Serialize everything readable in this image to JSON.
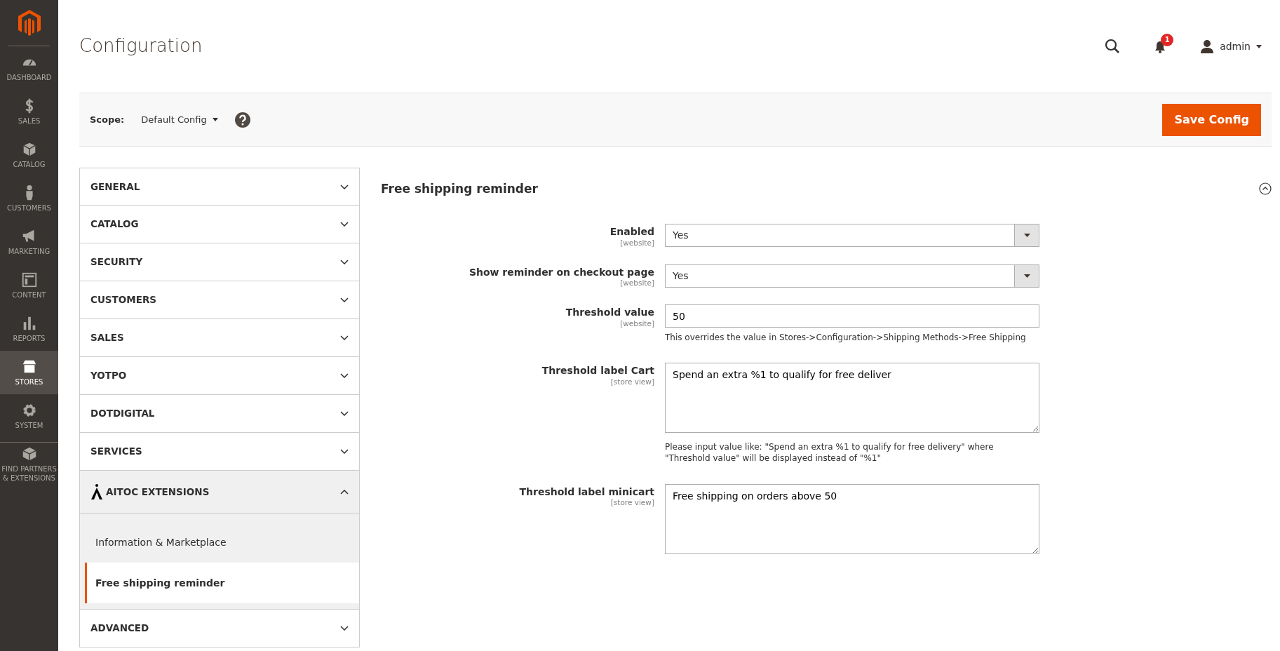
{
  "sidebar": {
    "items": [
      {
        "label": "DASHBOARD",
        "selected": false
      },
      {
        "label": "SALES",
        "selected": false
      },
      {
        "label": "CATALOG",
        "selected": false
      },
      {
        "label": "CUSTOMERS",
        "selected": false
      },
      {
        "label": "MARKETING",
        "selected": false
      },
      {
        "label": "CONTENT",
        "selected": false
      },
      {
        "label": "REPORTS",
        "selected": false
      },
      {
        "label": "STORES",
        "selected": true
      },
      {
        "label": "SYSTEM",
        "selected": false
      },
      {
        "label": "FIND PARTNERS & EXTENSIONS",
        "selected": false
      }
    ]
  },
  "header": {
    "title": "Configuration",
    "notification_count": "1",
    "user": "admin"
  },
  "scope_bar": {
    "label": "Scope:",
    "value": "Default Config",
    "button": "Save Config"
  },
  "config_nav": [
    {
      "label": "GENERAL",
      "expanded": false
    },
    {
      "label": "CATALOG",
      "expanded": false
    },
    {
      "label": "SECURITY",
      "expanded": false
    },
    {
      "label": "CUSTOMERS",
      "expanded": false
    },
    {
      "label": "SALES",
      "expanded": false
    },
    {
      "label": "YOTPO",
      "expanded": false
    },
    {
      "label": "DOTDIGITAL",
      "expanded": false
    },
    {
      "label": "SERVICES",
      "expanded": false
    },
    {
      "label": "AITOC EXTENSIONS",
      "expanded": true,
      "children": [
        {
          "label": "Information & Marketplace",
          "selected": false
        },
        {
          "label": "Free shipping reminder",
          "selected": true
        }
      ]
    },
    {
      "label": "ADVANCED",
      "expanded": false
    }
  ],
  "section": {
    "title": "Free shipping reminder",
    "fields": [
      {
        "kind": "select",
        "label": "Enabled",
        "scope": "[website]",
        "value": "Yes"
      },
      {
        "kind": "select",
        "label": "Show reminder on checkout page",
        "scope": "[website]",
        "value": "Yes"
      },
      {
        "kind": "text",
        "label": "Threshold value",
        "scope": "[website]",
        "value": "50",
        "note": "This overrides the value in Stores->Configuration->Shipping Methods->Free Shipping"
      },
      {
        "kind": "textarea",
        "label": "Threshold label Cart",
        "scope": "[store view]",
        "value": "Spend an extra %1 to qualify for free deliver",
        "note": "Please input value like: \"Spend an extra %1 to qualify for free delivery\" where \"Threshold value\" will be displayed instead of \"%1\""
      },
      {
        "kind": "textarea",
        "label": "Threshold label minicart",
        "scope": "[store view]",
        "value": "Free shipping on orders above 50"
      }
    ]
  }
}
